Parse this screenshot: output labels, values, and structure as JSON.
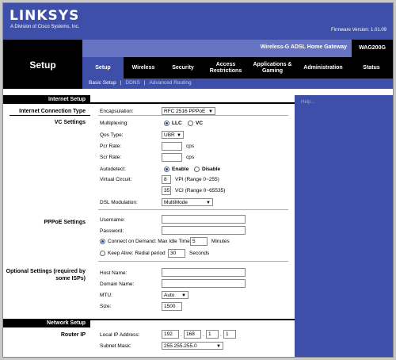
{
  "header": {
    "logo": "LINKSYS",
    "logo_sub": "A Division of Cisco Systems, Inc.",
    "firmware": "Firmware Version: 1.01.09",
    "product_name": "Wireless-G ADSL Home Gateway",
    "model": "WAG200G",
    "page_title": "Setup"
  },
  "tabs": [
    "Setup",
    "Wireless",
    "Security",
    "Access Restrictions",
    "Applications & Gaming",
    "Administration",
    "Status"
  ],
  "subtabs": {
    "basic": "Basic Setup",
    "ddns": "DDNS",
    "advanced": "Advanced Routing",
    "sep": "|"
  },
  "sections": {
    "internet_setup": "Internet Setup",
    "internet_connection_type": "Internet Connection Type",
    "vc_settings": "VC Settings",
    "pppoe_settings": "PPPoE Settings",
    "optional_settings": "Optional Settings (required by some ISPs)",
    "network_setup": "Network Setup",
    "router_ip": "Router IP"
  },
  "form": {
    "encapsulation_label": "Encapsulation:",
    "encapsulation_value": "RFC 2516 PPPoE",
    "multiplexing_label": "Multiplexing:",
    "llc": "LLC",
    "vc": "VC",
    "qos_label": "Qos Type:",
    "qos_value": "UBR",
    "pcr_label": "Pcr Rate:",
    "scr_label": "Scr Rate:",
    "cps": "cps",
    "autodetect_label": "Autodetect:",
    "enable": "Enable",
    "disable": "Disable",
    "vc_label": "Virtual Circuit:",
    "vpi_value": "8",
    "vpi_range": "VPI (Range 0~255)",
    "vci_value": "35",
    "vci_range": "VCI (Range 0~65535)",
    "dsl_label": "DSL Modulation:",
    "dsl_value": "MultiMode",
    "username_label": "Username:",
    "password_label": "Password:",
    "connect_demand": "Connect on Demand: Max Idle Time",
    "idle_value": "5",
    "minutes": "Minutes",
    "keep_alive": "Keep Alive: Redial period",
    "redial_value": "30",
    "seconds": "Seconds",
    "host_label": "Host Name:",
    "domain_label": "Domain Name:",
    "mtu_label": "MTU:",
    "mtu_value": "Auto",
    "size_label": "Size:",
    "size_value": "1500",
    "local_ip_label": "Local IP Address:",
    "ip1": "192",
    "ip2": "168",
    "ip3": "1",
    "ip4": "1",
    "subnet_label": "Subnet Mask:",
    "subnet_value": "255.255.255.0"
  },
  "help": "Help...",
  "colors": {
    "blue": "#3d4fa8",
    "purple": "#6673c2",
    "black": "#000000"
  }
}
